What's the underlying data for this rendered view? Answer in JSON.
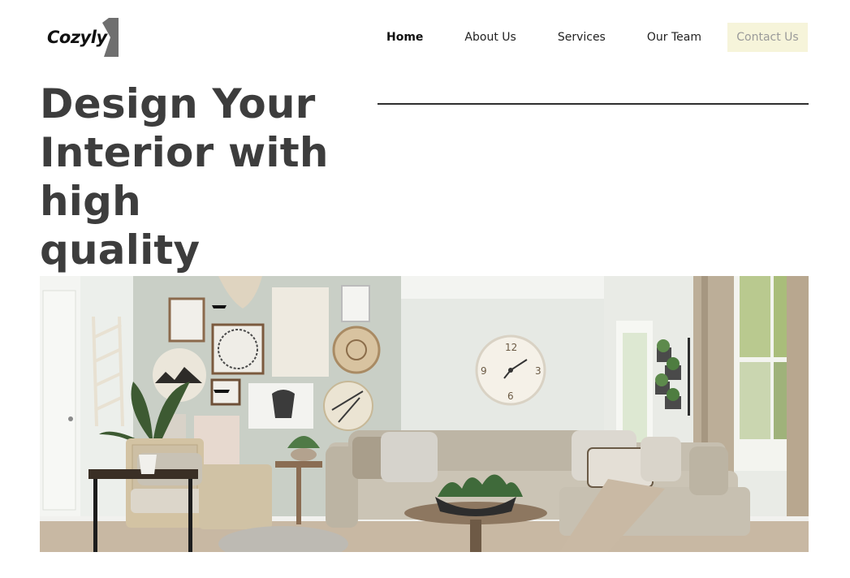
{
  "brand": {
    "name": "Cozyly"
  },
  "nav": {
    "items": [
      {
        "label": "Home",
        "active": true
      },
      {
        "label": "About Us"
      },
      {
        "label": "Services"
      },
      {
        "label": "Our Team"
      }
    ],
    "contact_label": "Contact Us"
  },
  "hero": {
    "title_lines": [
      "Design Your",
      "Interior with high",
      "quality"
    ]
  },
  "colors": {
    "heading": "#3d3d3d",
    "contact_bg": "#f6f4da",
    "contact_text": "#9a9a9a",
    "logo_mark": "#6f6f6f"
  }
}
